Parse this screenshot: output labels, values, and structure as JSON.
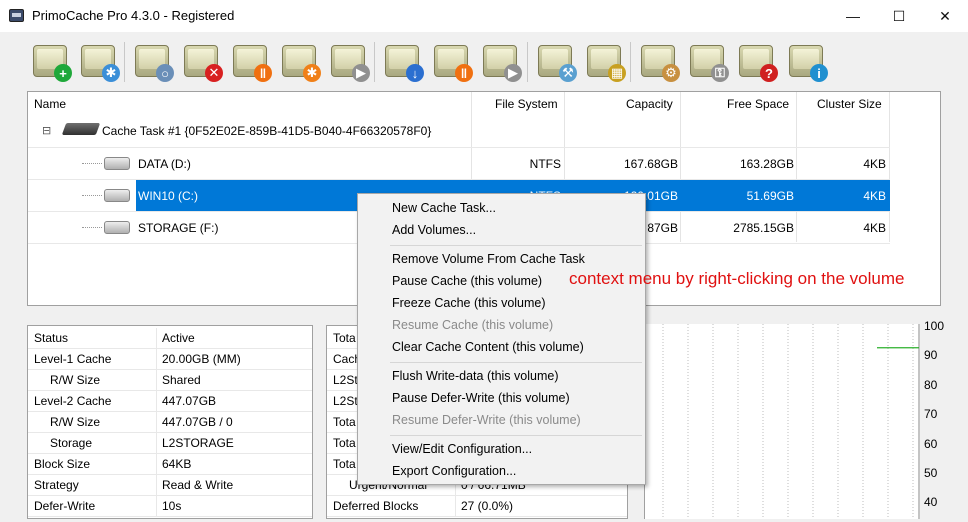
{
  "window": {
    "title": "PrimoCache Pro 4.3.0 - Registered",
    "minimize": "—",
    "maximize": "☐",
    "close": "✕"
  },
  "toolbar": [
    {
      "name": "new-cache-task-button",
      "badge": "+",
      "color": "#1fa83a"
    },
    {
      "name": "add-volumes-button",
      "badge": "✱",
      "color": "#3b8fd8"
    },
    {
      "name": "find-button",
      "badge": "○",
      "color": "#6a8fb8"
    },
    {
      "name": "remove-button",
      "badge": "✕",
      "color": "#d82020"
    },
    {
      "name": "pause-cache-button",
      "badge": "‖",
      "color": "#f07010"
    },
    {
      "name": "freeze-cache-button",
      "badge": "✱",
      "color": "#f08018"
    },
    {
      "name": "resume-cache-button",
      "badge": "▶",
      "color": "#909090"
    },
    {
      "name": "flush-write-data-button",
      "badge": "↓",
      "color": "#2b6fd0"
    },
    {
      "name": "pause-defer-write-button",
      "badge": "‖",
      "color": "#f07010"
    },
    {
      "name": "resume-defer-write-button",
      "badge": "▶",
      "color": "#909090"
    },
    {
      "name": "tools-button",
      "badge": "⚒",
      "color": "#5aa0d0"
    },
    {
      "name": "memory-button",
      "badge": "▦",
      "color": "#c8a020"
    },
    {
      "name": "settings-button",
      "badge": "⚙",
      "color": "#c89040"
    },
    {
      "name": "license-button",
      "badge": "⚿",
      "color": "#909090"
    },
    {
      "name": "help-button",
      "badge": "?",
      "color": "#d02020"
    },
    {
      "name": "about-button",
      "badge": "i",
      "color": "#2090d0"
    }
  ],
  "grid": {
    "columns": [
      "Name",
      "File System",
      "Capacity",
      "Free Space",
      "Cluster Size"
    ],
    "task_label": "Cache Task #1 {0F52E02E-859B-41D5-B040-4F66320578F0}",
    "tree_toggle": "⊟",
    "rows": [
      {
        "name": "DATA (D:)",
        "fs": "NTFS",
        "capacity": "167.68GB",
        "free": "163.28GB",
        "cluster": "4KB"
      },
      {
        "name": "WIN10 (C:)",
        "fs": "NTFS",
        "capacity": "120.01GB",
        "free": "51.69GB",
        "cluster": "4KB"
      },
      {
        "name": "STORAGE (F:)",
        "fs": "",
        "capacity": "87GB",
        "free": "2785.15GB",
        "cluster": "4KB"
      }
    ]
  },
  "left_panel": [
    {
      "k": "Status",
      "v": "Active",
      "indent": false
    },
    {
      "k": "Level-1 Cache",
      "v": "20.00GB (MM)",
      "indent": false
    },
    {
      "k": "R/W Size",
      "v": "Shared",
      "indent": true
    },
    {
      "k": "Level-2 Cache",
      "v": "447.07GB",
      "indent": false
    },
    {
      "k": "R/W Size",
      "v": "447.07GB / 0",
      "indent": true
    },
    {
      "k": "Storage",
      "v": "L2STORAGE",
      "indent": true
    },
    {
      "k": "Block Size",
      "v": "64KB",
      "indent": false
    },
    {
      "k": "Strategy",
      "v": "Read & Write",
      "indent": false
    },
    {
      "k": "Defer-Write",
      "v": "10s",
      "indent": false
    }
  ],
  "mid_panel": [
    {
      "k": "Tota",
      "v": ""
    },
    {
      "k": "Cach",
      "v": ""
    },
    {
      "k": "L2St",
      "v": ""
    },
    {
      "k": "L2St",
      "v": ""
    },
    {
      "k": "Tota",
      "v": ""
    },
    {
      "k": "Tota",
      "v": ""
    },
    {
      "k": "Tota",
      "v": ""
    },
    {
      "k": "Urgent/Normal",
      "v": "0 / 66.71MB"
    },
    {
      "k": "Deferred Blocks",
      "v": "27 (0.0%)"
    }
  ],
  "chart": {
    "ticks": [
      "100",
      "90",
      "80",
      "70",
      "60",
      "50",
      "40"
    ],
    "line_color": "#2bb02b",
    "line_value": 96
  },
  "context_menu": {
    "items": [
      {
        "label": "New Cache Task...",
        "disabled": false,
        "sep_after": false
      },
      {
        "label": "Add Volumes...",
        "disabled": false,
        "sep_after": true
      },
      {
        "label": "Remove Volume From Cache Task",
        "disabled": false,
        "sep_after": false
      },
      {
        "label": "Pause Cache (this volume)",
        "disabled": false,
        "sep_after": false
      },
      {
        "label": "Freeze Cache (this volume)",
        "disabled": false,
        "sep_after": false
      },
      {
        "label": "Resume Cache (this volume)",
        "disabled": true,
        "sep_after": false
      },
      {
        "label": "Clear Cache Content (this volume)",
        "disabled": false,
        "sep_after": true
      },
      {
        "label": "Flush Write-data (this volume)",
        "disabled": false,
        "sep_after": false
      },
      {
        "label": "Pause Defer-Write (this volume)",
        "disabled": false,
        "sep_after": false
      },
      {
        "label": "Resume Defer-Write (this volume)",
        "disabled": true,
        "sep_after": true
      },
      {
        "label": "View/Edit Configuration...",
        "disabled": false,
        "sep_after": false
      },
      {
        "label": "Export Configuration...",
        "disabled": false,
        "sep_after": false
      }
    ]
  },
  "annotation": "context menu by right-clicking on the volume",
  "colors": {
    "selection": "#0078d7",
    "annotation": "#e01010"
  }
}
